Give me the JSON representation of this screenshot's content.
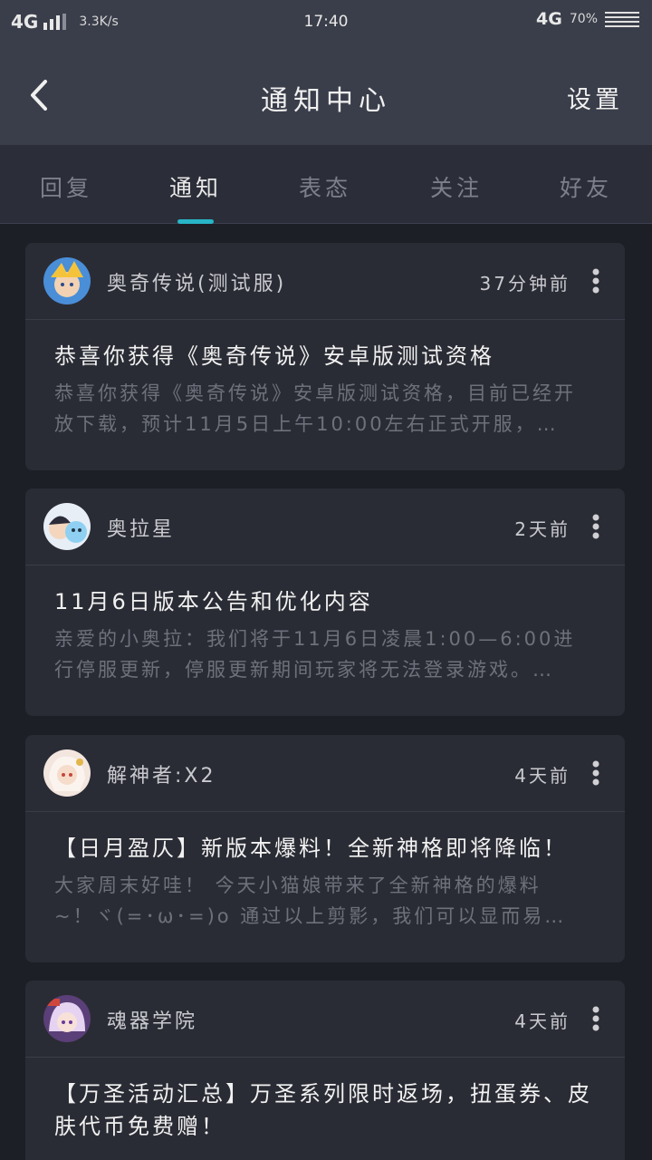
{
  "status_bar": {
    "network_left": "4G",
    "speed": "3.3K/s",
    "time": "17:40",
    "network_right": "4G",
    "battery": "70%"
  },
  "header": {
    "title": "通知中心",
    "settings_label": "设置",
    "back_icon": "chevron-left-icon"
  },
  "tabs": [
    {
      "label": "回复"
    },
    {
      "label": "通知",
      "active": true
    },
    {
      "label": "表态"
    },
    {
      "label": "关注"
    },
    {
      "label": "好友"
    }
  ],
  "colors": {
    "accent": "#27b5c7",
    "header_bg": "#3a3e4a",
    "card_bg": "#2a2c35"
  },
  "notifications": [
    {
      "source": "奥奇传说(测试服)",
      "time": "37分钟前",
      "title": "恭喜你获得《奥奇传说》安卓版测试资格",
      "summary": "恭喜你获得《奥奇传说》安卓版测试资格，目前已经开放下载，预计11月5日上午10:00左右正式开服，…"
    },
    {
      "source": "奥拉星",
      "time": "2天前",
      "title": "11月6日版本公告和优化内容",
      "summary": "亲爱的小奥拉：我们将于11月6日凌晨1:00—6:00进行停服更新，停服更新期间玩家将无法登录游戏。…"
    },
    {
      "source": "解神者:X2",
      "time": "4天前",
      "title": "【日月盈仄】新版本爆料！全新神格即将降临！",
      "summary": "大家周末好哇！ 今天小猫娘带来了全新神格的爆料~！ヾ(=･ω･=)o 通过以上剪影，我们可以显而易…"
    },
    {
      "source": "魂器学院",
      "time": "4天前",
      "title": "【万圣活动汇总】万圣系列限时返场，扭蛋券、皮肤代币免费赠！",
      "summary": ""
    }
  ]
}
